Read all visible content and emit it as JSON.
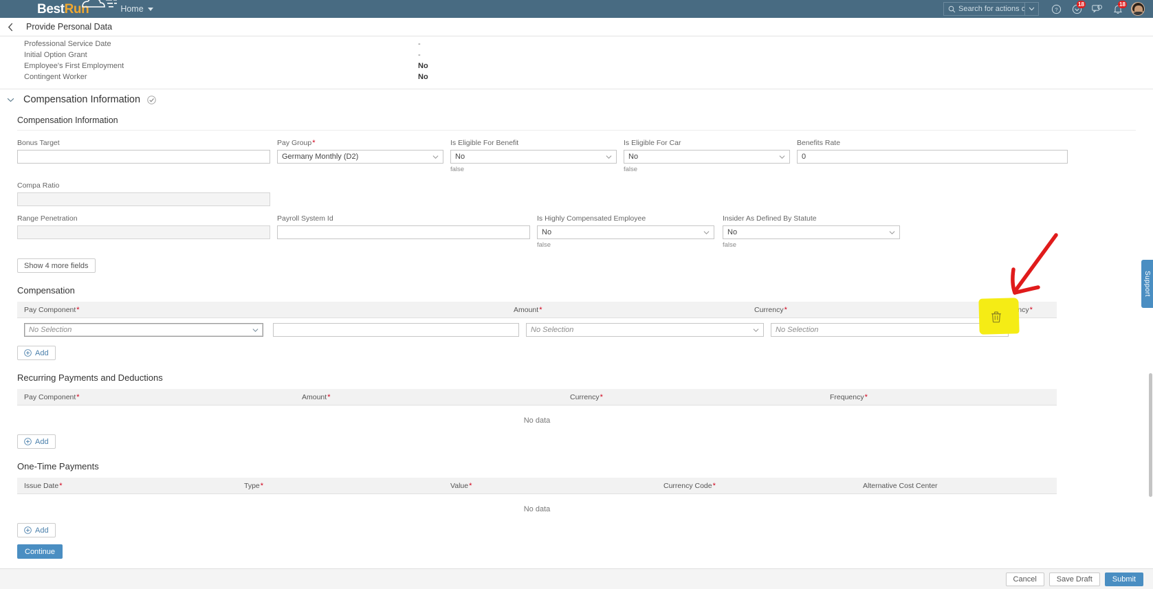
{
  "shell": {
    "brand_best": "Best",
    "brand_run": "Run",
    "home_label": "Home",
    "search_placeholder": "Search for actions or peo...",
    "icons": {
      "search": "search-icon",
      "dropdown": "chevron-down-icon",
      "help": "help-icon",
      "todo": "todo-icon",
      "chat": "chat-icon",
      "bell": "notification-bell-icon",
      "avatar": "user-avatar"
    },
    "todo_badge": "18",
    "bell_badge": "18"
  },
  "page": {
    "title": "Provide Personal Data",
    "back_icon": "chevron-left-icon"
  },
  "summary_fields": [
    {
      "label": "Professional Service Date",
      "value": "-",
      "dash": true
    },
    {
      "label": "Initial Option Grant",
      "value": "-",
      "dash": true
    },
    {
      "label": "Employee's First Employment",
      "value": "No",
      "dash": false
    },
    {
      "label": "Contingent Worker",
      "value": "No",
      "dash": false
    }
  ],
  "compensation_section": {
    "header_title": "Compensation Information",
    "panel_title": "Compensation Information",
    "fields": {
      "bonus_target": {
        "label": "Bonus Target",
        "value": "",
        "required": false,
        "type": "text",
        "disabled": false
      },
      "pay_group": {
        "label": "Pay Group",
        "value": "Germany Monthly (D2)",
        "required": true,
        "type": "select",
        "disabled": false
      },
      "is_eligible_for_benefit": {
        "label": "Is Eligible For Benefit",
        "value": "No",
        "required": false,
        "type": "select",
        "note": "false"
      },
      "is_eligible_for_car": {
        "label": "Is Eligible For Car",
        "value": "No",
        "required": false,
        "type": "select",
        "note": "false"
      },
      "benefits_rate": {
        "label": "Benefits Rate",
        "value": "0",
        "required": false,
        "type": "text"
      },
      "compa_ratio": {
        "label": "Compa Ratio",
        "value": "",
        "required": false,
        "type": "text",
        "disabled": true
      },
      "range_penetration": {
        "label": "Range Penetration",
        "value": "",
        "required": false,
        "type": "text",
        "disabled": true
      },
      "payroll_system_id": {
        "label": "Payroll System Id",
        "value": "",
        "required": false,
        "type": "text"
      },
      "is_highly_compensated_employee": {
        "label": "Is Highly Compensated Employee",
        "value": "No",
        "required": false,
        "type": "select",
        "note": "false"
      },
      "insider_as_defined_by_statute": {
        "label": "Insider As Defined By Statute",
        "value": "No",
        "required": false,
        "type": "select",
        "note": "false"
      }
    },
    "show_more_label": "Show 4 more fields"
  },
  "compensation_table": {
    "title": "Compensation",
    "headers": [
      "Pay Component",
      "Amount",
      "Currency",
      "Frequency"
    ],
    "headers_required": [
      true,
      true,
      true,
      true
    ],
    "row": {
      "pay_component": "No Selection",
      "amount": "",
      "currency": "No Selection",
      "frequency": "No Selection"
    },
    "delete_icon": "trash-icon",
    "add_label": "Add"
  },
  "recurring_table": {
    "title": "Recurring Payments and Deductions",
    "headers": [
      "Pay Component",
      "Amount",
      "Currency",
      "Frequency"
    ],
    "headers_required": [
      true,
      true,
      true,
      true
    ],
    "empty_text": "No data",
    "add_label": "Add"
  },
  "onetime_table": {
    "title": "One-Time Payments",
    "headers": [
      "Issue Date",
      "Type",
      "Value",
      "Currency Code",
      "Alternative Cost Center"
    ],
    "headers_required": [
      true,
      true,
      true,
      true,
      false
    ],
    "empty_text": "No data",
    "add_label": "Add"
  },
  "continue_label": "Continue",
  "footer": {
    "cancel": "Cancel",
    "save_draft": "Save Draft",
    "submit": "Submit"
  },
  "support_tab": {
    "label": "Support"
  },
  "colors": {
    "shell_bg": "#486b82",
    "brand_accent": "#f0a830",
    "primary": "#4a8ec2",
    "required": "#d0021b",
    "badge": "#e02020",
    "annotation_highlight": "#f5ec15",
    "annotation_arrow": "#e01b1b"
  }
}
